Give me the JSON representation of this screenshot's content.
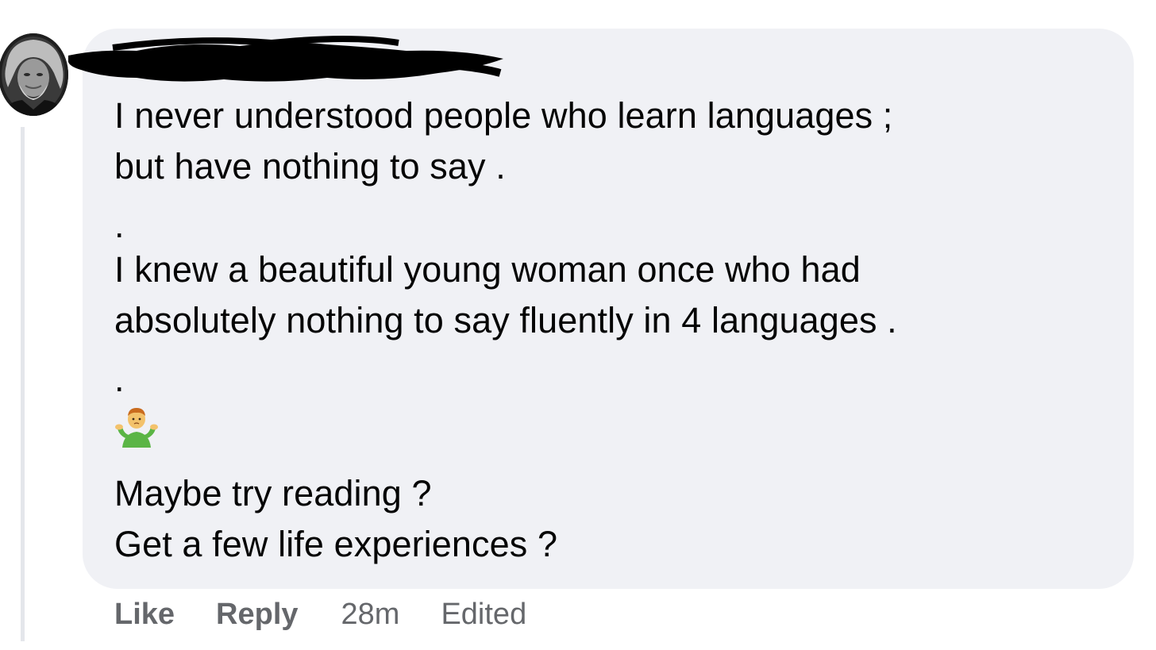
{
  "comment": {
    "author_name": "",
    "body_lines": [
      "I never understood people who learn languages ;",
      "but have nothing to say .",
      ".",
      "I knew a beautiful young woman once who had",
      "absolutely nothing to say fluently in 4 languages .",
      ".",
      "Maybe try reading ?",
      "Get a few life experiences ?"
    ],
    "emoji": "man-shrugging-emoji",
    "actions": {
      "like_label": "Like",
      "reply_label": "Reply",
      "timestamp": "28m",
      "edited_label": "Edited"
    }
  },
  "colors": {
    "bubble_background": "#f0f1f5",
    "text": "#050505",
    "muted_text": "#65676b",
    "thread_line": "#e4e6eb",
    "redaction": "#000000"
  },
  "icons": {
    "avatar": "profile-photo-avatar",
    "redaction": "scribble-redaction"
  }
}
